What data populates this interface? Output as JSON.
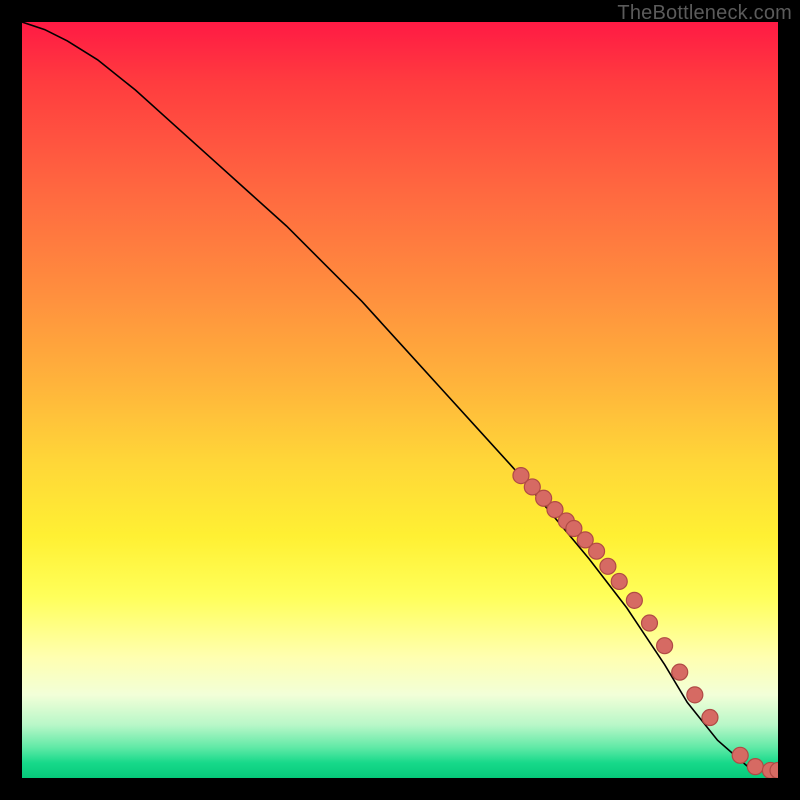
{
  "watermark": "TheBottleneck.com",
  "chart_data": {
    "type": "line",
    "title": "",
    "xlabel": "",
    "ylabel": "",
    "xlim": [
      0,
      100
    ],
    "ylim": [
      0,
      100
    ],
    "grid": false,
    "series": [
      {
        "name": "curve",
        "kind": "line",
        "x": [
          0,
          3,
          6,
          10,
          15,
          20,
          25,
          30,
          35,
          40,
          45,
          50,
          55,
          60,
          65,
          70,
          75,
          80,
          85,
          88,
          92,
          96,
          100
        ],
        "y": [
          100,
          99,
          97.5,
          95,
          91,
          86.5,
          82,
          77.5,
          73,
          68,
          63,
          57.5,
          52,
          46.5,
          41,
          35,
          29,
          22.5,
          15,
          10,
          5,
          1.5,
          1
        ]
      },
      {
        "name": "markers",
        "kind": "scatter",
        "x": [
          66,
          67.5,
          69,
          70.5,
          72,
          73,
          74.5,
          76,
          77.5,
          79,
          81,
          83,
          85,
          87,
          89,
          91,
          95,
          97,
          99,
          100
        ],
        "y": [
          40,
          38.5,
          37,
          35.5,
          34,
          33,
          31.5,
          30,
          28,
          26,
          23.5,
          20.5,
          17.5,
          14,
          11,
          8,
          3,
          1.5,
          1,
          1
        ]
      }
    ]
  }
}
